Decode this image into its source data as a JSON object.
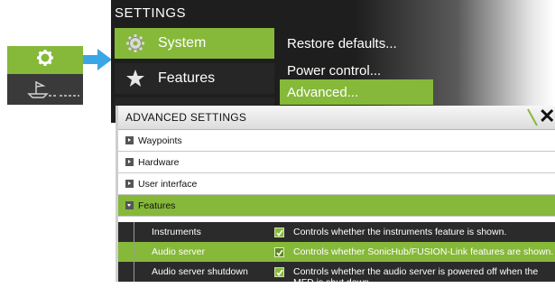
{
  "colors": {
    "accent": "#86b83a",
    "dark_panel": "#1e1e1e",
    "dialog_header": "#e6e6e6",
    "arrow": "#3aa6e6"
  },
  "callout": {
    "top_icon": "gear-icon",
    "bottom_icon": "boat-icon"
  },
  "settings": {
    "title": "SETTINGS",
    "menu": [
      {
        "label": "System",
        "icon": "gear-icon",
        "selected": true
      },
      {
        "label": "Features",
        "icon": "star-icon",
        "selected": false
      },
      {
        "label": "",
        "icon": "",
        "selected": false
      }
    ],
    "submenu": [
      {
        "label": "Restore defaults...",
        "selected": false
      },
      {
        "label": "Power control...",
        "selected": false
      },
      {
        "label": "Advanced...",
        "selected": true
      }
    ]
  },
  "advanced": {
    "title": "ADVANCED SETTINGS",
    "close_icon": "close-icon",
    "tree": [
      {
        "label": "Waypoints",
        "expanded": false
      },
      {
        "label": "Hardware",
        "expanded": false
      },
      {
        "label": "User interface",
        "expanded": false
      },
      {
        "label": "Features",
        "expanded": true
      }
    ],
    "features": [
      {
        "name": "Instruments",
        "checked": true,
        "description": "Controls whether the instruments feature is shown."
      },
      {
        "name": "Audio server",
        "checked": true,
        "description": "Controls whether SonicHub/FUSION-Link features are shown."
      },
      {
        "name": "Audio server shutdown",
        "checked": true,
        "description": "Controls whether the audio server is powered off when the MFD is shut down."
      }
    ]
  }
}
